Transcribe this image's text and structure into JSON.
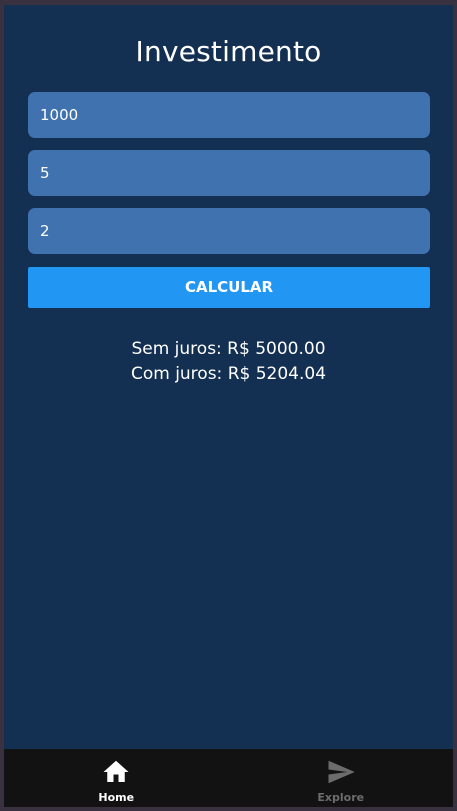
{
  "screen": {
    "title": "Investimento"
  },
  "form": {
    "fields": [
      {
        "name": "value",
        "value": "1000"
      },
      {
        "name": "months",
        "value": "5"
      },
      {
        "name": "rate",
        "value": "2"
      }
    ],
    "calculate_label": "CALCULAR"
  },
  "results": {
    "simple": "Sem juros: R$ 5000.00",
    "compound": "Com juros: R$ 5204.04"
  },
  "tabbar": {
    "tabs": [
      {
        "label": "Home",
        "icon": "home-icon",
        "active": true
      },
      {
        "label": "Explore",
        "icon": "send-icon",
        "active": false
      }
    ]
  },
  "colors": {
    "background": "#132f52",
    "input": "#4172b0",
    "button": "#2196f3",
    "tabbar": "#121212",
    "tab_active": "#ffffff",
    "tab_inactive": "#6c6c6c"
  }
}
